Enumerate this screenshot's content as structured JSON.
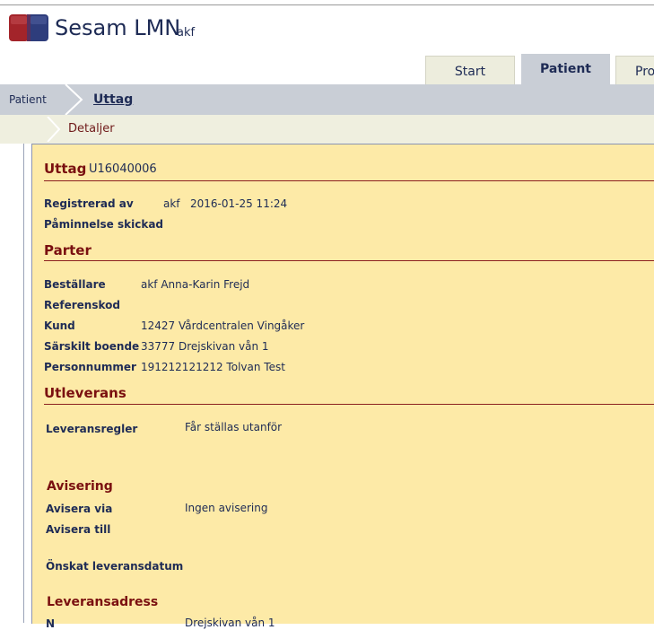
{
  "app": {
    "title": "Sesam LMN",
    "user": "akf"
  },
  "tabs": [
    "Start",
    "Patient",
    "Pro"
  ],
  "breadcrumb": {
    "parent": "Patient",
    "current": "Uttag",
    "sub": "Detaljer"
  },
  "uttag": {
    "title": "Uttag",
    "id": "U16040006",
    "registrerad_label": "Registrerad av",
    "registrerad_user": "akf",
    "registrerad_date": "2016-01-25 11:24",
    "paminnelse_label": "Påminnelse skickad"
  },
  "parter": {
    "title": "Parter",
    "rows": [
      {
        "label": "Beställare",
        "value": "akf Anna-Karin Frejd"
      },
      {
        "label": "Referenskod",
        "value": ""
      },
      {
        "label": "Kund",
        "value": "12427 Vårdcentralen Vingåker"
      },
      {
        "label": "Särskilt boende",
        "value": "33777 Drejskivan vån 1"
      },
      {
        "label": "Personnummer",
        "value": "191212121212 Tolvan Test"
      }
    ]
  },
  "utleverans": {
    "title": "Utleverans",
    "leveransregler_label": "Leveransregler",
    "leveransregler_value": "Får ställas utanför",
    "avisering_title": "Avisering",
    "avisera_via_label": "Avisera via",
    "avisera_via_value": "Ingen avisering",
    "avisera_till_label": "Avisera till",
    "onskat_label": "Önskat leveransdatum",
    "leveransadress_title": "Leveransadress",
    "partial_label": "N",
    "partial_value": "Drejskivan vån 1"
  },
  "colors": {
    "nav_bar": "#c9ced6",
    "content_bg": "#fdeaa7",
    "heading": "#7a1010",
    "text": "#1e2b55"
  }
}
